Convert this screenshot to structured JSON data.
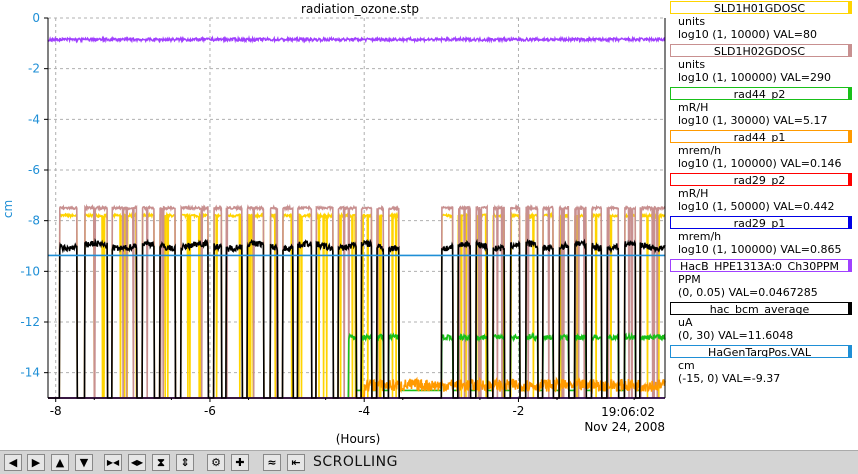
{
  "chart_data": {
    "type": "line",
    "title": "radiation_ozone.stp",
    "ylabel": "cm",
    "xlabel": "(Hours)",
    "xlim": [
      -8.1,
      -0.1
    ],
    "ylim": [
      -15,
      0
    ],
    "x_ticks": [
      "-8",
      "-6",
      "-4",
      "-2"
    ],
    "x_tick_values": [
      -8,
      -6,
      -4,
      -2
    ],
    "y_ticks": [
      "0",
      "-2",
      "-4",
      "-6",
      "-8",
      "-10",
      "-12",
      "-14"
    ],
    "y_tick_values": [
      0,
      -2,
      -4,
      -6,
      -8,
      -10,
      -12,
      -14
    ],
    "grid": true,
    "time_label": "19:06:02",
    "date_label": "Nov 24, 2008",
    "colors": {
      "axis_blue": "#1f8fd6"
    },
    "series": [
      {
        "name": "SLD1H01GDOSC",
        "color": "#ffd400",
        "kind": "beam_yellow",
        "y_on": -7.8,
        "y_off": -15
      },
      {
        "name": "SLD1H02GDOSC",
        "color": "#c89090",
        "kind": "beam_pink",
        "y_on": -7.5,
        "y_off": -15
      },
      {
        "name": "rad44_p2",
        "color": "#19c019",
        "kind": "rad_green",
        "y_hi": -12.5,
        "y_lo": -15,
        "x_start": -4.2
      },
      {
        "name": "rad44_p1",
        "color": "#ff9a00",
        "kind": "rad_orange",
        "y_base": -14.5,
        "x_start": -4.0
      },
      {
        "name": "rad29_p2",
        "color": "#ff0000",
        "kind": "flat_bottom",
        "y": -15
      },
      {
        "name": "rad29_p1",
        "color": "#0000e6",
        "kind": "flat_bottom",
        "y": -15
      },
      {
        "name": "HacB_HPE1313A:0_Ch30PPM",
        "color": "#a040ff",
        "kind": "noisy_const",
        "y": -0.85
      },
      {
        "name": "hac_bcm_average",
        "color": "#000000",
        "kind": "beam_black",
        "y_on": -9.0,
        "y_off": -15
      },
      {
        "name": "HaGenTargPos.VAL",
        "color": "#1f8fd6",
        "kind": "const",
        "y": -9.37
      }
    ],
    "beam_off_intervals": [
      [
        -8.1,
        -7.95
      ],
      [
        -7.72,
        -7.62
      ],
      [
        -7.33,
        -7.27
      ],
      [
        -6.95,
        -6.88
      ],
      [
        -6.72,
        -6.65
      ],
      [
        -6.45,
        -6.38
      ],
      [
        -6.02,
        -5.95
      ],
      [
        -5.85,
        -5.79
      ],
      [
        -5.58,
        -5.52
      ],
      [
        -5.3,
        -5.22
      ],
      [
        -5.12,
        -5.06
      ],
      [
        -4.92,
        -4.86
      ],
      [
        -4.68,
        -4.62
      ],
      [
        -4.4,
        -4.34
      ],
      [
        -4.1,
        -4.04
      ],
      [
        -3.9,
        -3.84
      ],
      [
        -3.75,
        -3.68
      ],
      [
        -3.55,
        -3.0
      ],
      [
        -2.85,
        -2.78
      ],
      [
        -2.62,
        -2.55
      ],
      [
        -2.4,
        -2.33
      ],
      [
        -2.18,
        -2.1
      ],
      [
        -1.98,
        -1.9
      ],
      [
        -1.75,
        -1.68
      ],
      [
        -1.55,
        -1.47
      ],
      [
        -1.35,
        -1.27
      ],
      [
        -1.12,
        -1.05
      ],
      [
        -0.92,
        -0.85
      ],
      [
        -0.7,
        -0.62
      ],
      [
        -0.48,
        -0.42
      ]
    ]
  },
  "legend": [
    {
      "name": "SLD1H01GDOSC",
      "unit": "units",
      "range": "log10 (1, 10000) VAL=80",
      "color": "#ffd400"
    },
    {
      "name": "SLD1H02GDOSC",
      "unit": "units",
      "range": "log10 (1, 100000) VAL=290",
      "color": "#c89090"
    },
    {
      "name": "rad44_p2",
      "unit": "mR/H",
      "range": "log10 (1, 30000) VAL=5.17",
      "color": "#19c019"
    },
    {
      "name": "rad44_p1",
      "unit": "mrem/h",
      "range": "log10 (1, 100000) VAL=0.146",
      "color": "#ff9a00"
    },
    {
      "name": "rad29_p2",
      "unit": "mR/H",
      "range": "log10 (1, 50000) VAL=0.442",
      "color": "#ff0000"
    },
    {
      "name": "rad29_p1",
      "unit": "mrem/h",
      "range": "log10 (1, 100000) VAL=0.865",
      "color": "#0000e6"
    },
    {
      "name": "HacB_HPE1313A:0_Ch30PPM",
      "unit": "PPM",
      "range": "(0, 0.05) VAL=0.0467285",
      "color": "#a040ff"
    },
    {
      "name": "hac_bcm_average",
      "unit": "uA",
      "range": "(0, 30) VAL=11.6048",
      "color": "#000000"
    },
    {
      "name": "HaGenTargPos.VAL",
      "unit": "cm",
      "range": "(-15, 0) VAL=-9.37",
      "color": "#1f8fd6"
    }
  ],
  "toolbar": {
    "buttons": [
      {
        "icon": "arrow-left-icon",
        "glyph": "◀"
      },
      {
        "icon": "arrow-right-icon",
        "glyph": "▶"
      },
      {
        "icon": "arrow-up-icon",
        "glyph": "▲"
      },
      {
        "icon": "arrow-down-icon",
        "glyph": "▼"
      },
      {
        "icon": "zoom-in-horizontal-icon",
        "glyph": "▶◀"
      },
      {
        "icon": "zoom-out-horizontal-icon",
        "glyph": "◀▶"
      },
      {
        "icon": "zoom-in-vertical-icon",
        "glyph": "⧗"
      },
      {
        "icon": "zoom-out-vertical-icon",
        "glyph": "⇕"
      },
      {
        "icon": "config-icon",
        "glyph": "⚙"
      },
      {
        "icon": "add-channel-icon",
        "glyph": "✚"
      },
      {
        "icon": "auto-scale-icon",
        "glyph": "≈"
      },
      {
        "icon": "scroll-mode-icon",
        "glyph": "⇤"
      }
    ],
    "mode_label": "SCROLLING"
  }
}
